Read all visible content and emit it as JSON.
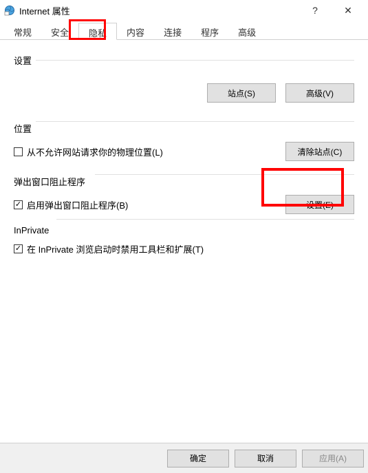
{
  "titlebar": {
    "title": "Internet 属性",
    "help": "?",
    "close": "✕"
  },
  "tabs": {
    "items": [
      {
        "label": "常规"
      },
      {
        "label": "安全"
      },
      {
        "label": "隐私"
      },
      {
        "label": "内容"
      },
      {
        "label": "连接"
      },
      {
        "label": "程序"
      },
      {
        "label": "高级"
      }
    ],
    "active_index": 2
  },
  "sections": {
    "settings": {
      "label": "设置",
      "sites_btn": "站点(S)",
      "advanced_btn": "高级(V)"
    },
    "location": {
      "label": "位置",
      "checkbox_label": "从不允许网站请求你的物理位置(L)",
      "checked": false,
      "clear_btn": "清除站点(C)"
    },
    "popup": {
      "label": "弹出窗口阻止程序",
      "checkbox_label": "启用弹出窗口阻止程序(B)",
      "checked": true,
      "settings_btn": "设置(E)"
    },
    "inprivate": {
      "label": "InPrivate",
      "checkbox_label": "在 InPrivate 浏览启动时禁用工具栏和扩展(T)",
      "checked": true
    }
  },
  "footer": {
    "ok": "确定",
    "cancel": "取消",
    "apply": "应用(A)"
  }
}
